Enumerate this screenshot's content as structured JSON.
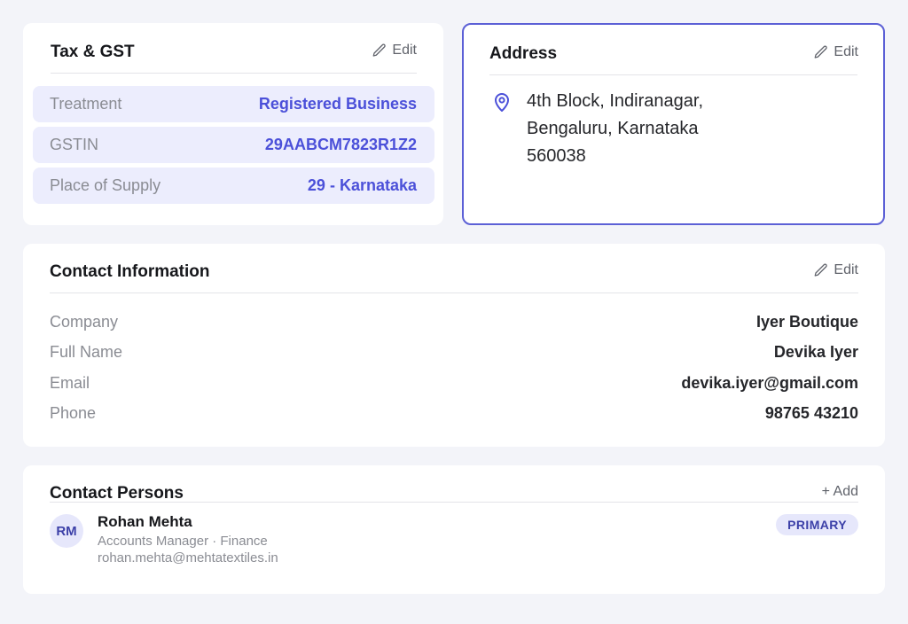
{
  "tax": {
    "title": "Tax & GST",
    "edit_label": "Edit",
    "rows": [
      {
        "label": "Treatment",
        "value": "Registered Business"
      },
      {
        "label": "GSTIN",
        "value": "29AABCM7823R1Z2"
      },
      {
        "label": "Place of Supply",
        "value": "29 - Karnataka"
      }
    ]
  },
  "address": {
    "title": "Address",
    "edit_label": "Edit",
    "lines": [
      "4th Block, Indiranagar,",
      "Bengaluru, Karnataka",
      "560038"
    ]
  },
  "contact_info": {
    "title": "Contact Information",
    "edit_label": "Edit",
    "rows": [
      {
        "label": "Company",
        "value": "Iyer Boutique"
      },
      {
        "label": "Full Name",
        "value": "Devika Iyer"
      },
      {
        "label": "Email",
        "value": "devika.iyer@gmail.com"
      },
      {
        "label": "Phone",
        "value": "98765 43210"
      }
    ]
  },
  "contact_persons": {
    "title": "Contact Persons",
    "add_label": "+ Add",
    "persons": [
      {
        "initials": "RM",
        "name": "Rohan Mehta",
        "role": "Accounts Manager · Finance",
        "email": "rohan.mehta@mehtatextiles.in",
        "badge": "PRIMARY"
      }
    ]
  },
  "colors": {
    "page_bg": "#f3f4f9",
    "accent": "#4b50d9",
    "row_bg": "#ecedfd",
    "active_border": "#5c60d6"
  },
  "icons": [
    "pencil-icon",
    "map-pin-icon"
  ]
}
